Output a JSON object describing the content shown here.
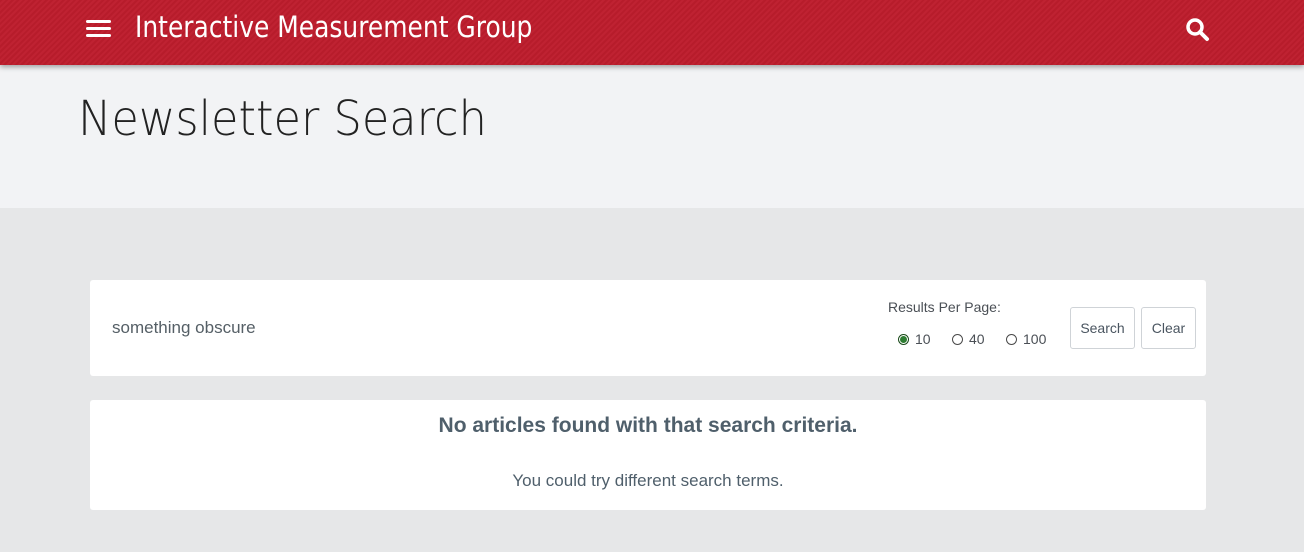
{
  "header": {
    "site_title": "Interactive Measurement Group",
    "menu_icon": "hamburger-menu-icon",
    "search_icon": "search-icon",
    "brand_color": "#bb1f2f"
  },
  "hero": {
    "title": "Newsletter Search"
  },
  "search": {
    "query_value": "something obscure",
    "results_per_page_label": "Results Per Page:",
    "options": [
      {
        "label": "10",
        "selected": true
      },
      {
        "label": "40",
        "selected": false
      },
      {
        "label": "100",
        "selected": false
      }
    ],
    "search_button_label": "Search",
    "clear_button_label": "Clear"
  },
  "results": {
    "message": "No articles found with that search criteria.",
    "suggestion": "You could try different search terms."
  }
}
